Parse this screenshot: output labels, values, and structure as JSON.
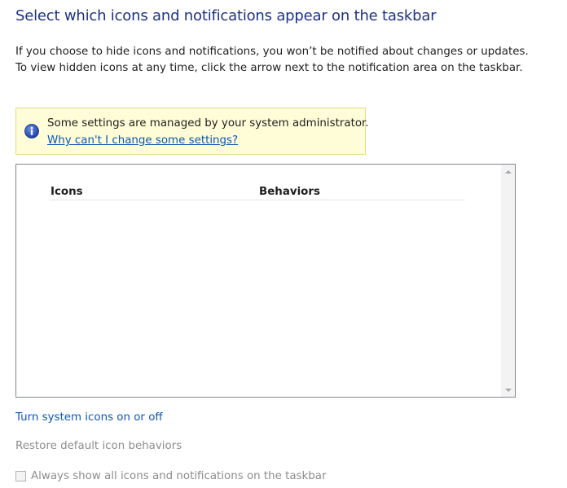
{
  "heading": "Select which icons and notifications appear on the taskbar",
  "description": "If you choose to hide icons and notifications, you won’t be notified about changes or updates. To view hidden icons at any time, click the arrow next to the notification area on the taskbar.",
  "info_box": {
    "message": "Some settings are managed by your system administrator.",
    "link": "Why can't I change some settings?",
    "icon": "info-icon"
  },
  "table": {
    "columns": [
      "Icons",
      "Behaviors"
    ],
    "rows": []
  },
  "links": {
    "system_icons": "Turn system icons on or off",
    "restore_defaults": "Restore default icon behaviors"
  },
  "always_show": {
    "label": "Always show all icons and notifications on the taskbar",
    "checked": false,
    "enabled": false
  },
  "colors": {
    "heading": "#1e3287",
    "link": "#0b56b7",
    "disabled_text": "#8d8d8d",
    "info_background": "#fefdd7",
    "info_border": "#e5dc8a"
  }
}
